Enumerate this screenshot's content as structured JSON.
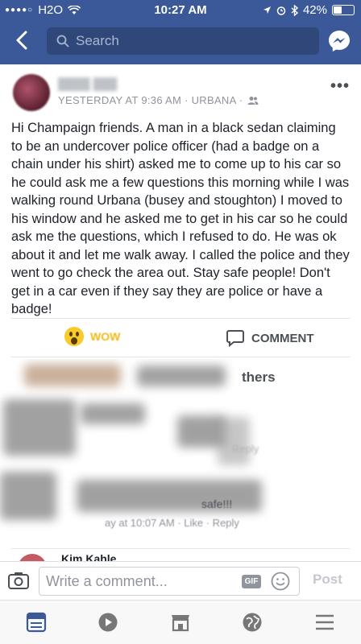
{
  "status_bar": {
    "carrier": "H2O",
    "time": "10:27 AM",
    "battery": "42%",
    "battery_level": 0.42
  },
  "nav": {
    "search_placeholder": "Search"
  },
  "post": {
    "meta": "YESTERDAY AT 9:36 AM · URBANA ·",
    "text": "Hi Champaign friends. A man in a black sedan claiming to be an undercover police officer (had a badge on a chain under his shirt) asked me to come up to his car so he could ask me a few questions this morning while I was walking round Urbana (busey and stoughton) I moved to his window and he asked me to get in his car so he could ask me the questions, which I refused to do. He was ok about it and let me walk away. I called the police and they went to go check the area out. Stay safe people! Don't get in a car even if they say they are police or have a badge!",
    "more_icon": "ellipsis-icon",
    "reaction_label": "WOW",
    "comment_label": "COMMENT"
  },
  "comments": {
    "likers_partial": "thers",
    "reply_faint": "Reply",
    "blurred_text": "safe!!!",
    "blurred_meta": "ay at 10:07 AM · Like · Reply",
    "next_name": "Kim Kahle"
  },
  "composer": {
    "placeholder": "Write a comment...",
    "gif_label": "GIF",
    "post_label": "Post"
  },
  "colors": {
    "brand": "#3b5998",
    "wow_yellow": "#f7cb2e"
  }
}
